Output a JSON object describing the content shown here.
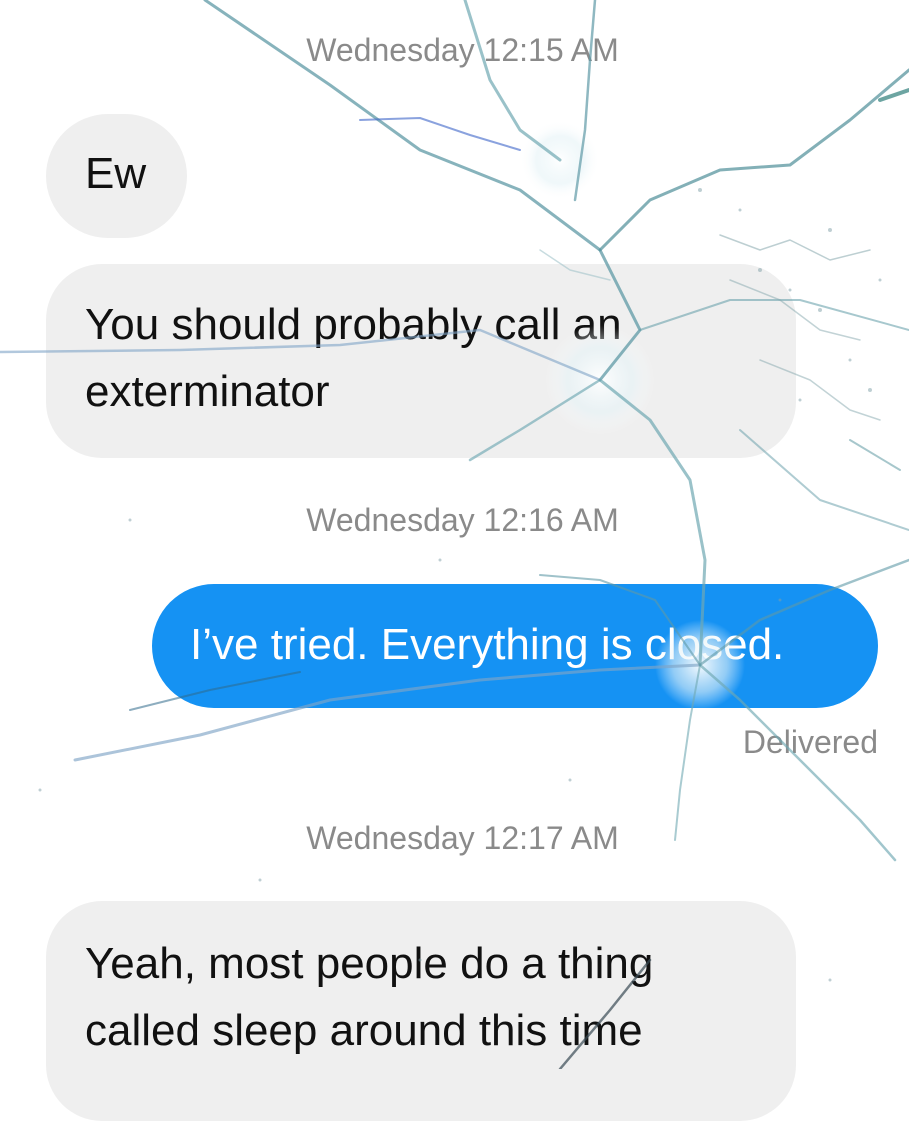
{
  "conversation": {
    "timestamp_1": "Wednesday 12:15 AM",
    "msg_1": "Ew",
    "msg_2_line_1": "You should probably call an",
    "msg_2_line_2": "exterminator",
    "timestamp_2": "Wednesday 12:16 AM",
    "msg_3": "I’ve tried. Everything is closed.",
    "status_3": "Delivered",
    "timestamp_3": "Wednesday 12:17 AM",
    "msg_4_line_1": "Yeah, most people do a thing",
    "msg_4_line_2": "called sleep around this time"
  },
  "colors": {
    "incoming_bubble": "#efefef",
    "outgoing_bubble": "#1592f3",
    "timestamp_text": "#8a8a8a",
    "background": "#ffffff"
  },
  "overlay": {
    "type": "cracked-screen-effect"
  }
}
